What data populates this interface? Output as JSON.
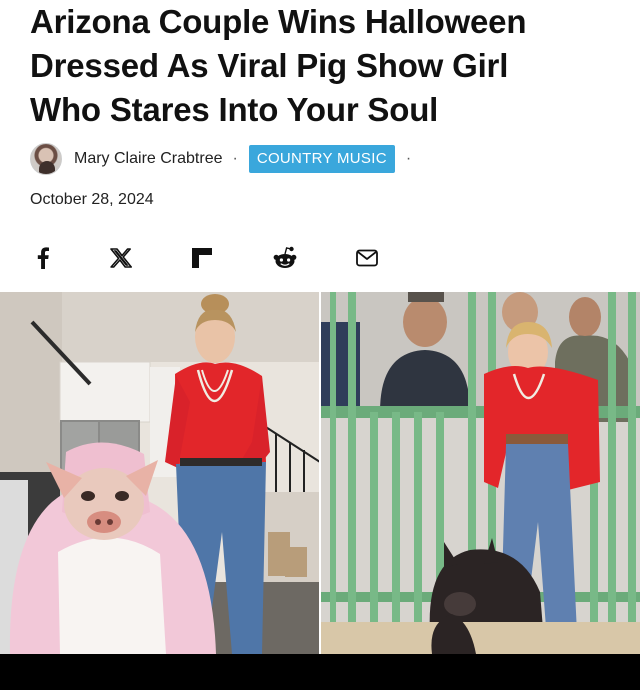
{
  "article": {
    "headline_lines": [
      "Arizona Couple Wins Halloween",
      "Dressed As Viral Pig Show Girl",
      "Who Stares Into Your Soul"
    ],
    "author": "Mary Claire Crabtree",
    "separator": "·",
    "category": "COUNTRY MUSIC",
    "date": "October 28, 2024"
  },
  "share": {
    "icons": [
      "facebook-icon",
      "x-icon",
      "flipboard-icon",
      "reddit-icon",
      "mail-icon"
    ]
  },
  "colors": {
    "category_badge": "#3aa7dc",
    "headline_text": "#111111",
    "bottom_bar": "#000000"
  }
}
